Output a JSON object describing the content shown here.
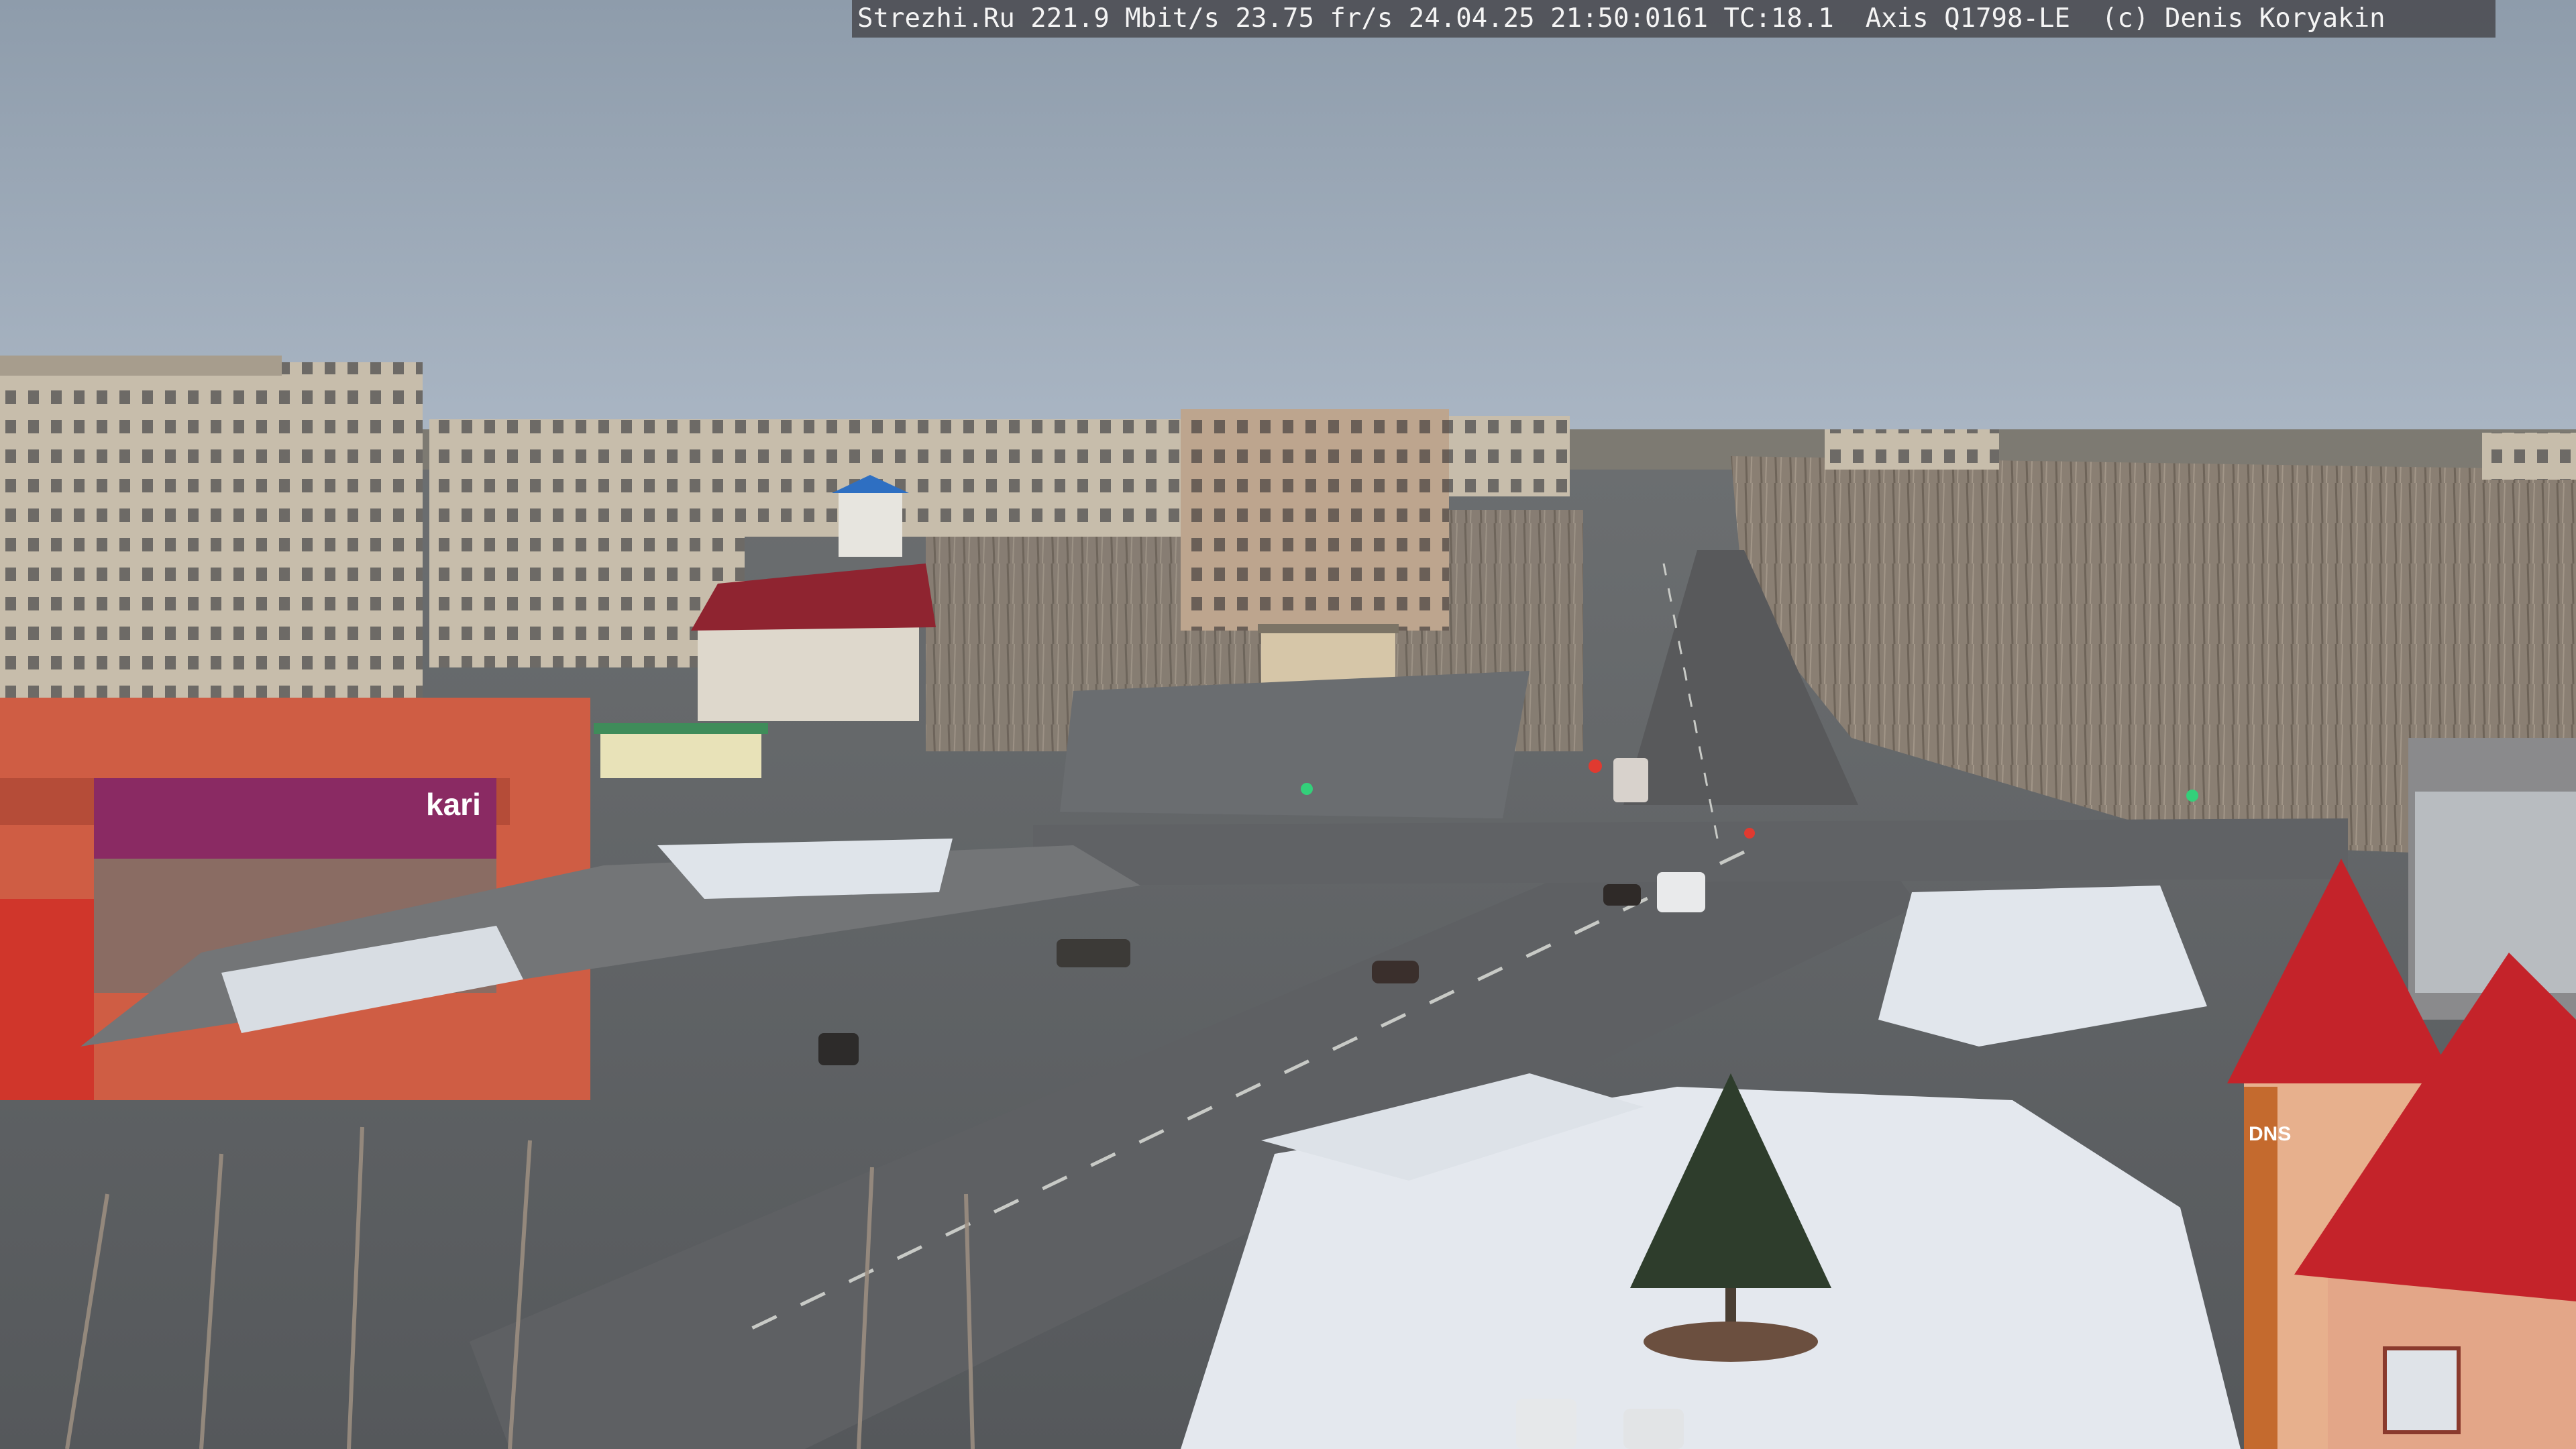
{
  "overlay": {
    "text": "Strezhi.Ru 221.9 Mbit/s 23.75 fr/s 24.04.25 21:50:0161 TC:18.1  Axis Q1798-LE  (c) Denis Koryakin"
  },
  "signage": {
    "kari_logo": "kari",
    "dns_logo": "DNS"
  },
  "colors": {
    "sky_top": "#8e9cab",
    "sky_bottom": "#a9b6c4",
    "asphalt": "#5f6266",
    "snow": "#dfe4ea",
    "red_roof": "#c2242b",
    "panel_building": "#c9bfae"
  }
}
